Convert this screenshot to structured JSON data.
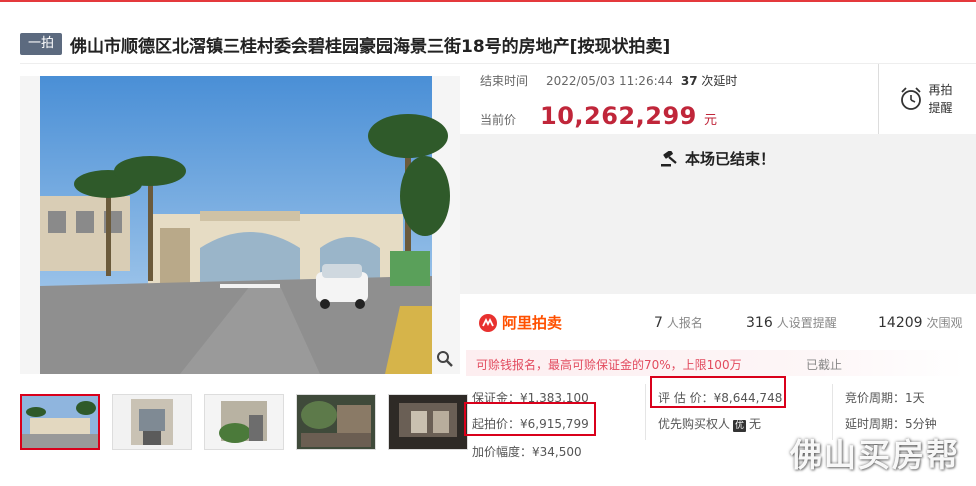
{
  "header": {
    "tag": "一拍",
    "title": "佛山市顺德区北滘镇三桂村委会碧桂园豪园海景三街18号的房地产[按现状拍卖]"
  },
  "auction": {
    "end_time_label": "结束时间",
    "end_time_value": "2022/05/03 11:26:44",
    "delay_count": "37",
    "delay_label": "次延时",
    "current_price_label": "当前价",
    "current_price": "10,262,299",
    "currency_unit": "元",
    "remind_label_1": "再拍",
    "remind_label_2": "提醒",
    "ended_message": "本场已结束！"
  },
  "platform": {
    "name": "阿里拍卖",
    "stats": [
      {
        "value": "7",
        "label": "人报名"
      },
      {
        "value": "316",
        "label": "人设置提醒"
      },
      {
        "value": "14209",
        "label": "次围观"
      }
    ]
  },
  "deposit": {
    "notice": "可赊钱报名，最高可赊保证金的70%，上限100万",
    "status": "已截止"
  },
  "details": {
    "deposit": "保证金：¥1,383,100",
    "start_price": "起拍价：¥6,915,799",
    "increment": "加价幅度：¥34,500",
    "appraisal": "评 估 价：¥8,644,748",
    "priority_buyer_label": "优先购买权人",
    "priority_badge": "优",
    "priority_buyer_value": "无",
    "bid_cycle": "竞价周期：1天",
    "delay_cycle": "延时周期：5分钟"
  },
  "watermark": "佛山买房帮",
  "colors": {
    "accent_red": "#c0263a",
    "box_red": "#d9001b",
    "ali_orange": "#ff5000",
    "tag_gray": "#5c6a7f"
  }
}
